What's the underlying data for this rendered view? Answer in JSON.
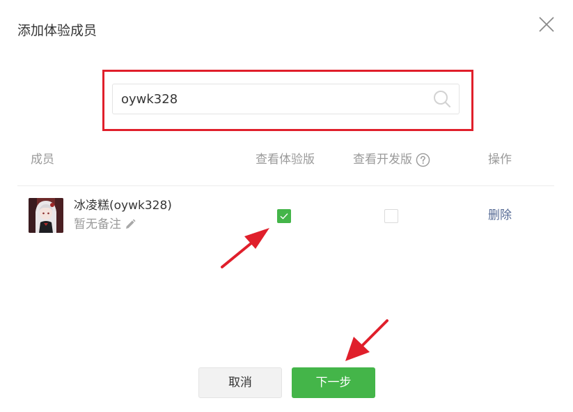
{
  "dialog": {
    "title": "添加体验成员"
  },
  "search": {
    "value": "oywk328"
  },
  "table": {
    "headers": {
      "member": "成员",
      "view_experience": "查看体验版",
      "view_dev": "查看开发版",
      "operation": "操作"
    },
    "rows": [
      {
        "name": "冰凌糕(oywk328)",
        "remark": "暂无备注",
        "view_experience": true,
        "view_dev": false,
        "action": "删除"
      }
    ]
  },
  "footer": {
    "cancel_label": "取消",
    "next_label": "下一步"
  },
  "colors": {
    "accent_green": "#44b549",
    "highlight_red": "#e01f2b",
    "link_blue": "#576b95"
  },
  "icons": {
    "close": "close-icon",
    "search": "search-icon",
    "help": "help-circle-icon",
    "edit": "pencil-icon",
    "check": "check-icon"
  }
}
